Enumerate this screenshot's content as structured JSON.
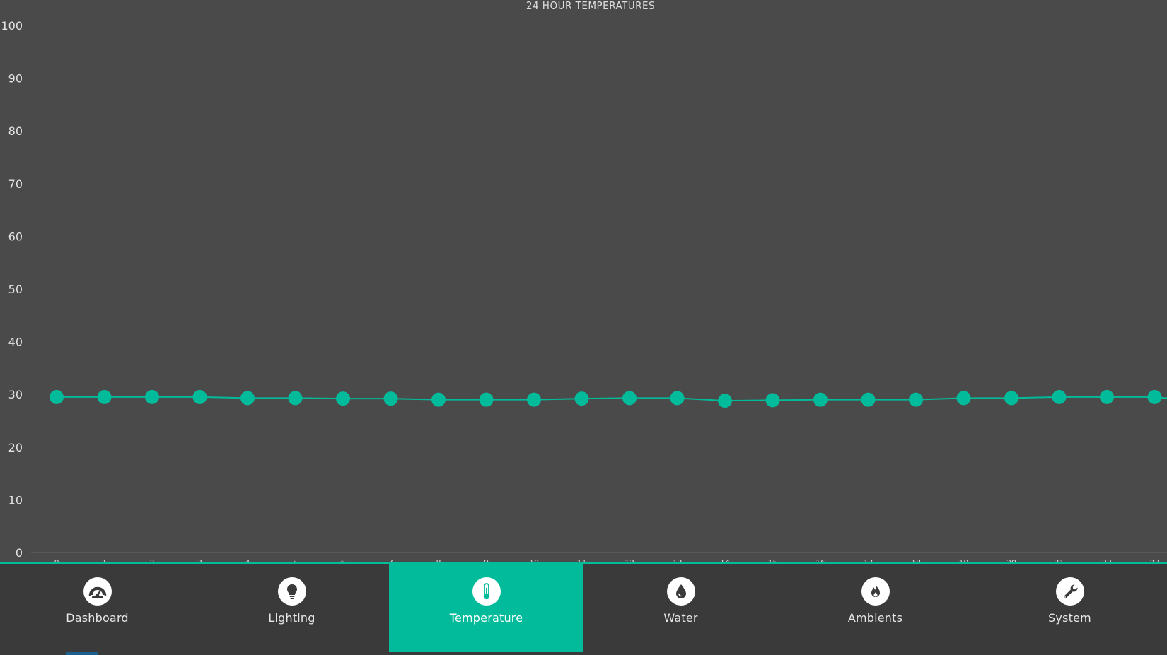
{
  "colors": {
    "background": "#4a4a4a",
    "nav_background": "#3a3a3a",
    "accent": "#02bb9b",
    "text": "#e4e4e4",
    "icon_fill": "#ffffff",
    "icon_glyph": "#3a3a3a"
  },
  "chart_data": {
    "type": "line",
    "title": "24 HOUR TEMPERATURES",
    "ylim": [
      0,
      100
    ],
    "y_ticks": [
      "0",
      "10",
      "20",
      "30",
      "40",
      "50",
      "60",
      "70",
      "80",
      "90",
      "100"
    ],
    "x": [
      "0",
      "1",
      "2",
      "3",
      "4",
      "5",
      "6",
      "7",
      "8",
      "9",
      "10",
      "11",
      "12",
      "13",
      "14",
      "15",
      "16",
      "17",
      "18",
      "19",
      "20",
      "21",
      "22",
      "23"
    ],
    "values": [
      29.5,
      29.5,
      29.5,
      29.5,
      29.3,
      29.3,
      29.2,
      29.2,
      29.0,
      29.0,
      29.0,
      29.2,
      29.3,
      29.3,
      28.8,
      28.9,
      29.0,
      29.0,
      29.0,
      29.3,
      29.3,
      29.5,
      29.5,
      29.5
    ],
    "trailing_value": 29.0,
    "grid": false,
    "legend": "none",
    "line_color": "#02bb9b"
  },
  "nav": {
    "items": [
      {
        "label": "Dashboard",
        "icon": "gauge-icon",
        "active": false
      },
      {
        "label": "Lighting",
        "icon": "lightbulb-icon",
        "active": false
      },
      {
        "label": "Temperature",
        "icon": "thermometer-icon",
        "active": true
      },
      {
        "label": "Water",
        "icon": "water-drop-icon",
        "active": false
      },
      {
        "label": "Ambients",
        "icon": "flame-icon",
        "active": false
      },
      {
        "label": "System",
        "icon": "wrench-icon",
        "active": false
      }
    ]
  }
}
